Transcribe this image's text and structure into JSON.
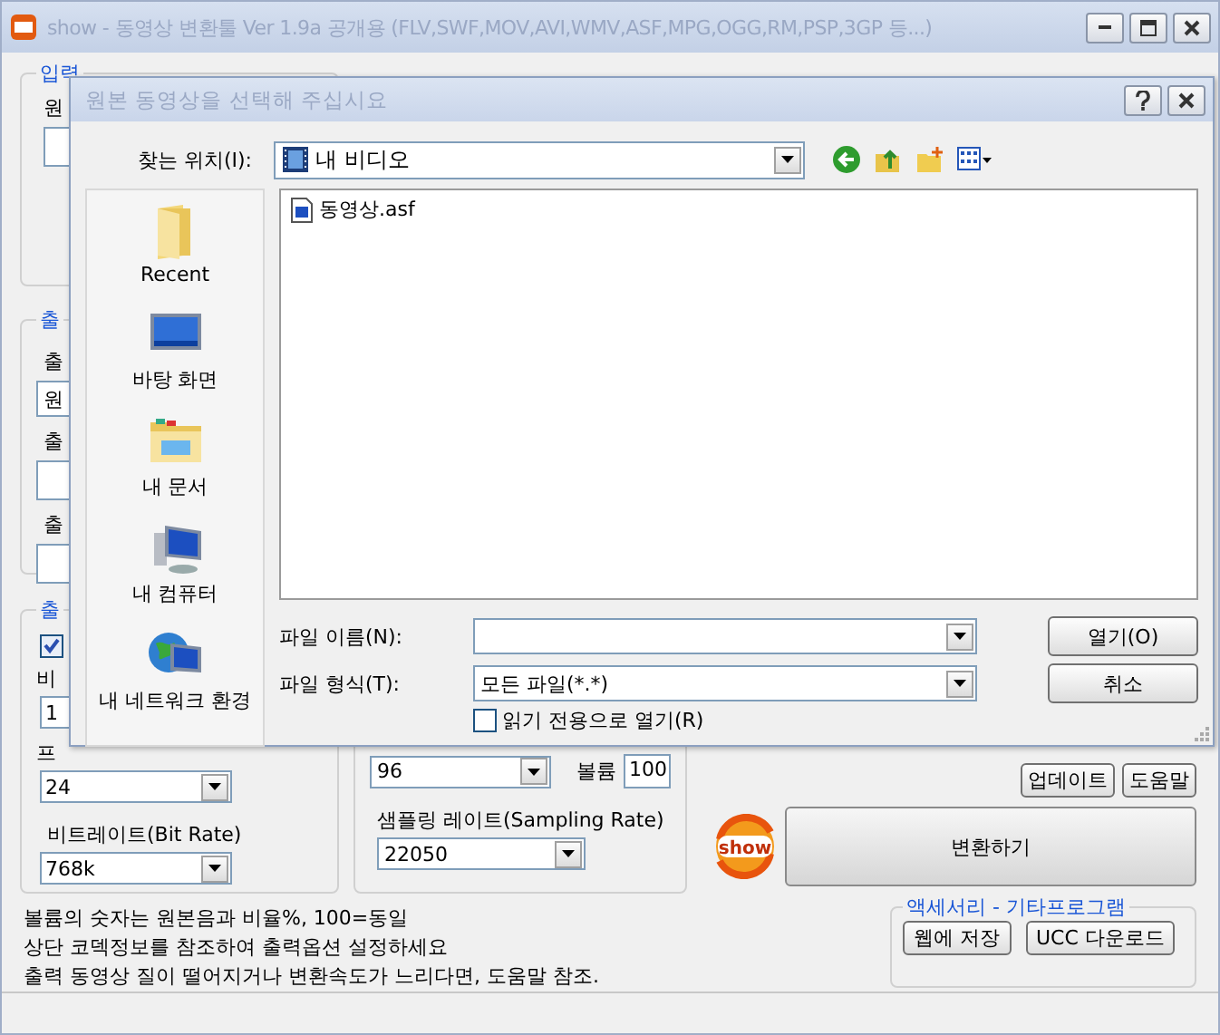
{
  "window": {
    "title": "show - 동영상 변환툴 Ver 1.9a 공개용 (FLV,SWF,MOV,AVI,WMV,ASF,MPG,OGG,RM,PSP,3GP 등...)"
  },
  "input_group": {
    "label": "입력",
    "source_label": "원"
  },
  "output_group": {
    "label": "출",
    "fields": [
      {
        "label": "출",
        "value": "원"
      },
      {
        "label": "출"
      },
      {
        "label": "출"
      }
    ]
  },
  "video_group": {
    "label": "출",
    "enabled": true,
    "fields": [
      {
        "label": "비",
        "value": "1"
      },
      {
        "label": "프",
        "value": "24"
      },
      {
        "label": "비트레이트(Bit Rate)",
        "value": "768k"
      }
    ]
  },
  "audio_group": {
    "fields": [
      {
        "value": "96"
      },
      {
        "label": "샘플링 레이트(Sampling Rate)",
        "value": "22050"
      }
    ],
    "volume_label": "볼륨",
    "volume": "100"
  },
  "tool_buttons": [
    "업데이트",
    "도움말"
  ],
  "logo_text": "show",
  "convert_button": "변환하기",
  "notes": [
    "볼륨의 숫자는 원본음과 비율%, 100=동일",
    "상단 코덱정보를 참조하여 출력옵션 설정하세요",
    "출력 동영상 질이 떨어지거나 변환속도가 느리다면, 도움말 참조."
  ],
  "accessories": {
    "label": "액세서리 - 기타프로그램",
    "buttons": [
      "웹에 저장",
      "UCC 다운로드"
    ]
  },
  "dialog": {
    "title": "원본 동영상을 선택해 주십시요",
    "look_in_label": "찾는 위치(I):",
    "look_in": "내 비디오",
    "places": [
      {
        "label": "Recent",
        "kind": "recent"
      },
      {
        "label": "바탕 화면",
        "kind": "desktop"
      },
      {
        "label": "내 문서",
        "kind": "documents"
      },
      {
        "label": "내 컴퓨터",
        "kind": "computer"
      },
      {
        "label": "내 네트워크 환경",
        "kind": "network"
      }
    ],
    "files": [
      {
        "name": "동영상.asf",
        "selected": false
      }
    ],
    "file_name_label": "파일 이름(N):",
    "file_type_label": "파일 형식(T):",
    "file_type": "모든 파일(*.*)",
    "read_only": {
      "label": "읽기 전용으로 열기(R)",
      "checked": false
    },
    "buttons": [
      "열기(O)",
      "취소"
    ]
  }
}
